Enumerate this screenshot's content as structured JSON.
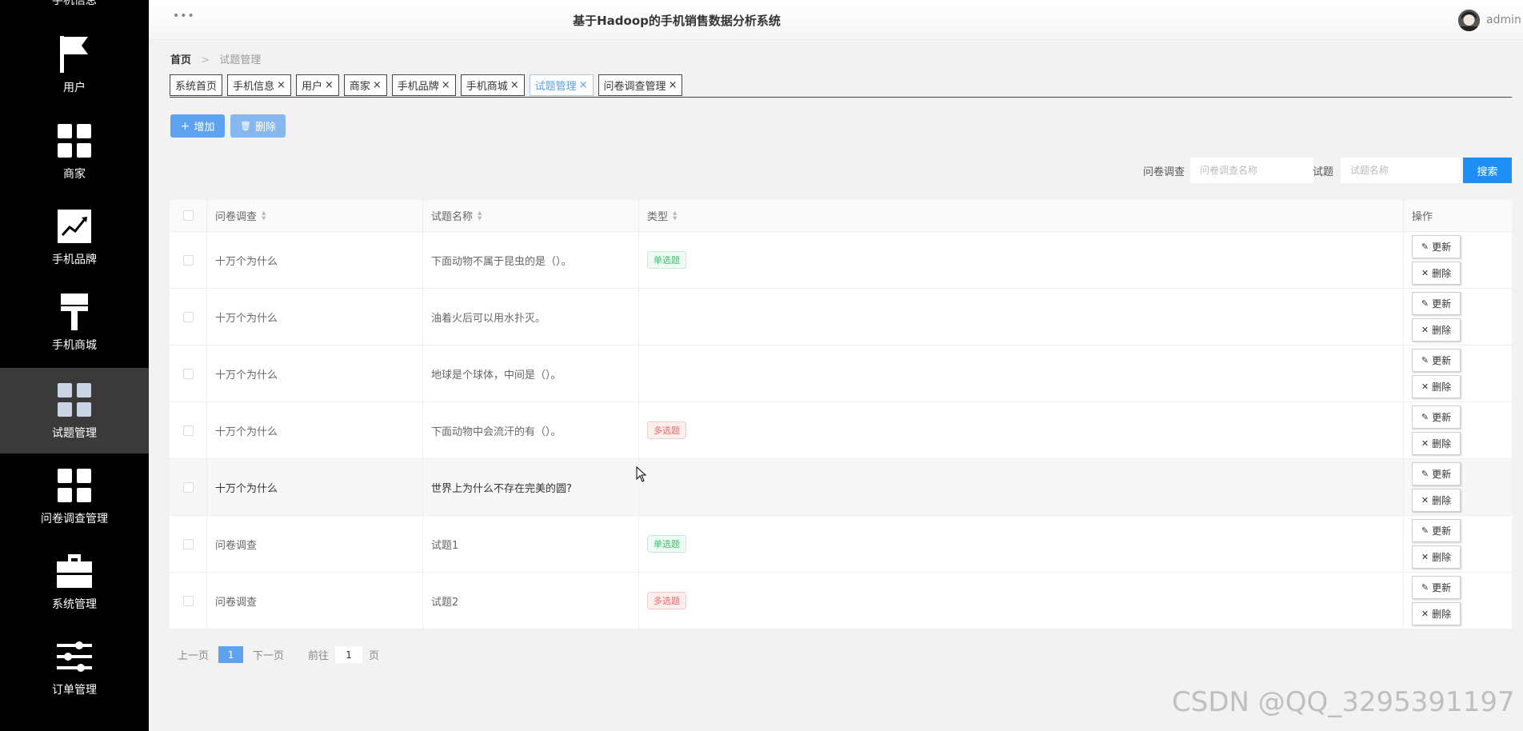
{
  "sidebar": {
    "top_cut_label": "手机信息",
    "items": [
      {
        "label": "用户",
        "icon": "flag-icon"
      },
      {
        "label": "商家",
        "icon": "grid-icon"
      },
      {
        "label": "手机品牌",
        "icon": "chart-line-icon"
      },
      {
        "label": "手机商城",
        "icon": "brush-icon"
      },
      {
        "label": "试题管理",
        "icon": "grid-icon",
        "active": true
      },
      {
        "label": "问卷调查管理",
        "icon": "grid-icon"
      },
      {
        "label": "系统管理",
        "icon": "briefcase-icon"
      },
      {
        "label": "订单管理",
        "icon": "sliders-icon"
      }
    ]
  },
  "header": {
    "dots": "•••",
    "title": "基于Hadoop的手机销售数据分析系统",
    "user": "admin"
  },
  "breadcrumb": {
    "home": "首页",
    "separator": ">",
    "current": "试题管理"
  },
  "tabs": [
    {
      "label": "系统首页",
      "closable": false
    },
    {
      "label": "手机信息",
      "closable": true
    },
    {
      "label": "用户",
      "closable": true
    },
    {
      "label": "商家",
      "closable": true
    },
    {
      "label": "手机品牌",
      "closable": true
    },
    {
      "label": "手机商城",
      "closable": true
    },
    {
      "label": "试题管理",
      "closable": true,
      "active": true
    },
    {
      "label": "问卷调查管理",
      "closable": true
    }
  ],
  "tab_close": "×",
  "toolbar": {
    "add_icon": "+",
    "add_label": "增加",
    "delete_icon": "🗑",
    "delete_label": "删除"
  },
  "search": {
    "survey_label": "问卷调查",
    "survey_placeholder": "问卷调查名称",
    "question_label": "试题",
    "question_placeholder": "试题名称",
    "search_label": "搜索"
  },
  "table": {
    "columns": {
      "survey": "问卷调查",
      "question": "试题名称",
      "type": "类型",
      "operation": "操作"
    },
    "sort_up": "▲",
    "sort_down": "▼",
    "update_label": "更新",
    "delete_label": "删除",
    "update_icon": "✎",
    "delete_icon": "✕",
    "rows": [
      {
        "survey": "十万个为什么",
        "question": "下面动物不属于昆虫的是（）。",
        "type": "单选题",
        "type_kind": "single"
      },
      {
        "survey": "十万个为什么",
        "question": "油着火后可以用水扑灭。",
        "type": "",
        "type_kind": "none"
      },
      {
        "survey": "十万个为什么",
        "question": "地球是个球体，中间是（）。",
        "type": "",
        "type_kind": "none"
      },
      {
        "survey": "十万个为什么",
        "question": "下面动物中会流汗的有（）。",
        "type": "多选题",
        "type_kind": "multi"
      },
      {
        "survey": "十万个为什么",
        "question": "世界上为什么不存在完美的圆?",
        "type": "",
        "type_kind": "none",
        "hover": true
      },
      {
        "survey": "问卷调查",
        "question": "试题1",
        "type": "单选题",
        "type_kind": "single"
      },
      {
        "survey": "问卷调查",
        "question": "试题2",
        "type": "多选题",
        "type_kind": "multi"
      }
    ]
  },
  "pagination": {
    "prev": "上一页",
    "current": "1",
    "next": "下一页",
    "goto_label": "前往",
    "goto_value": "1",
    "page_suffix": "页"
  },
  "watermark": "CSDN @QQ_3295391197",
  "colors": {
    "sidebar_bg": "#000000",
    "sidebar_active": "#3a3a3a",
    "primary": "#5ea3f0",
    "search_button": "#1e8ef5",
    "tag_single": "#41bb70",
    "tag_multi": "#e26a6a"
  }
}
